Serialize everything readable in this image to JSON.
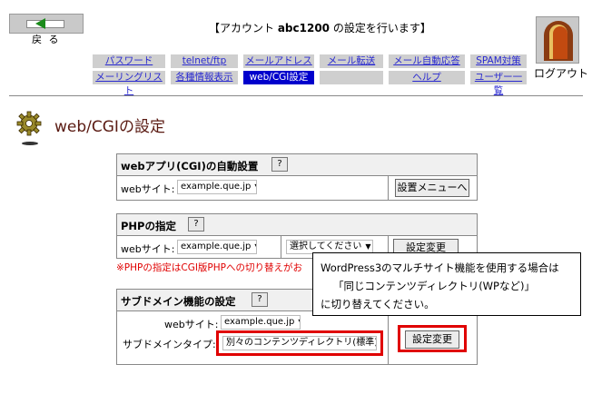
{
  "header": {
    "back_label": "戻 る",
    "title_prefix": "【アカウント ",
    "account": "abc1200",
    "title_suffix": " の設定を行います】",
    "logout_label": "ログアウト"
  },
  "nav": {
    "row1": [
      "パスワード",
      "telnet/ftp",
      "メールアドレス",
      "メール転送",
      "メール自動応答",
      "SPAM対策"
    ],
    "row2": [
      "メーリングリスト",
      "各種情報表示",
      "web/CGI設定",
      "",
      "ヘルプ",
      "ユーザー一覧"
    ]
  },
  "page": {
    "title": "web/CGIの設定"
  },
  "panel_app": {
    "title": "webアプリ(CGI)の自動設置",
    "help": "?",
    "site_label": "webサイト:",
    "site_value": "example.que.jp",
    "button": "設置メニューへ"
  },
  "panel_php": {
    "title": "PHPの指定",
    "help": "?",
    "site_label": "webサイト:",
    "site_value": "example.que.jp",
    "version_value": "選択してください",
    "button": "設定変更",
    "warning": "※PHPの指定はCGI版PHPへの切り替えがお"
  },
  "panel_subdomain": {
    "title": "サブドメイン機能の設定",
    "help": "?",
    "site_label": "webサイト:",
    "site_value": "example.que.jp",
    "type_label": "サブドメインタイプ:",
    "type_value": "別々のコンテンツディレクトリ(標準)",
    "button": "設定変更"
  },
  "tooltip": {
    "line1": "WordPress3のマルチサイト機能を使用する場合は",
    "line2": "「同じコンテンツディレクトリ(WPなど)」",
    "line3": "に切り替えてください。"
  },
  "colors": {
    "highlight": "#e00000",
    "active_nav": "#0000cc",
    "link": "#2a2ad0"
  }
}
